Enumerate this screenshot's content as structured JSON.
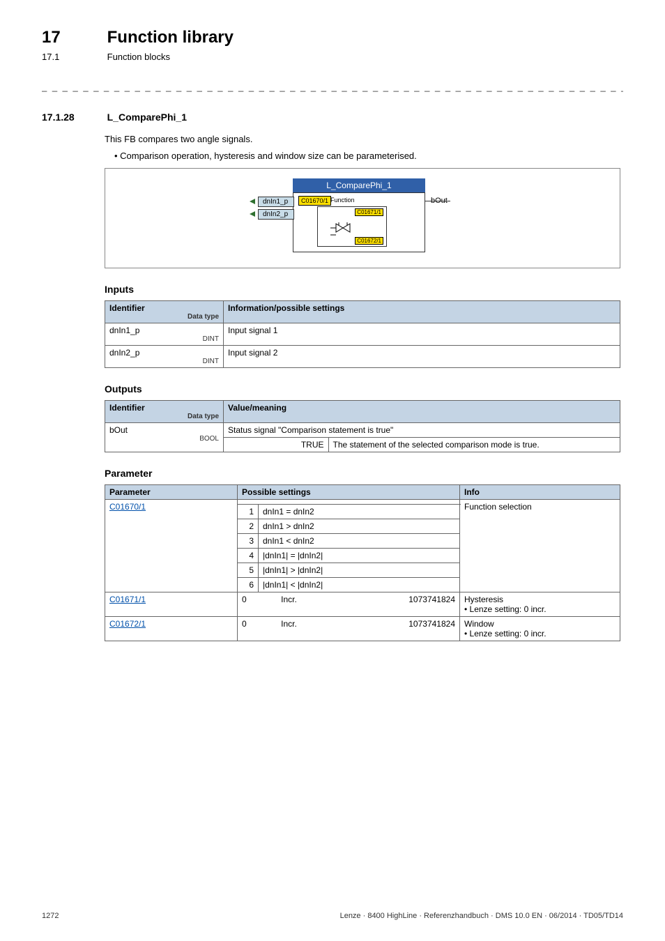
{
  "header": {
    "num": "17",
    "title": "Function library"
  },
  "subheader": {
    "num": "17.1",
    "title": "Function blocks"
  },
  "section": {
    "num": "17.1.28",
    "title": "L_ComparePhi_1"
  },
  "intro": "This FB compares two angle signals.",
  "bullet1": "• Comparison operation, hysteresis and window size can be parameterised.",
  "diagram": {
    "header": "L_ComparePhi_1",
    "in1": "dnIn1_p",
    "in2": "dnIn2_p",
    "out": "bOut",
    "funcCode": "C01670/1",
    "funcText": "Function",
    "p1": "C01671/1",
    "p2": "C01672/1"
  },
  "inputs": {
    "heading": "Inputs",
    "th1": "Identifier",
    "th2": "Information/possible settings",
    "dtLabel": "Data type",
    "r1": {
      "id": "dnIn1_p",
      "dt": "DINT",
      "info": "Input signal 1"
    },
    "r2": {
      "id": "dnIn2_p",
      "dt": "DINT",
      "info": "Input signal 2"
    }
  },
  "outputs": {
    "heading": "Outputs",
    "th1": "Identifier",
    "th2": "Value/meaning",
    "dtLabel": "Data type",
    "r1": {
      "id": "bOut",
      "dt": "BOOL",
      "info": "Status signal \"Comparison statement is true\"",
      "trueLabel": "TRUE",
      "trueText": "The statement of the selected comparison mode is true."
    }
  },
  "param": {
    "heading": "Parameter",
    "th1": "Parameter",
    "th2": "Possible settings",
    "th3": "Info",
    "p1": {
      "code": "C01670/1",
      "info": "Function selection",
      "opts": [
        {
          "n": "1",
          "t": "dnIn1 = dnIn2"
        },
        {
          "n": "2",
          "t": "dnIn1 > dnIn2"
        },
        {
          "n": "3",
          "t": "dnIn1 < dnIn2"
        },
        {
          "n": "4",
          "t": "|dnIn1| = |dnIn2|"
        },
        {
          "n": "5",
          "t": "|dnIn1| > |dnIn2|"
        },
        {
          "n": "6",
          "t": "|dnIn1| < |dnIn2|"
        }
      ]
    },
    "p2": {
      "code": "C01671/1",
      "low": "0",
      "unit": "Incr.",
      "high": "1073741824",
      "info1": "Hysteresis",
      "info2": "• Lenze setting: 0 incr."
    },
    "p3": {
      "code": "C01672/1",
      "low": "0",
      "unit": "Incr.",
      "high": "1073741824",
      "info1": "Window",
      "info2": "• Lenze setting: 0 incr."
    }
  },
  "footer": {
    "page": "1272",
    "text": "Lenze · 8400 HighLine · Referenzhandbuch · DMS 10.0 EN · 06/2014 · TD05/TD14"
  }
}
